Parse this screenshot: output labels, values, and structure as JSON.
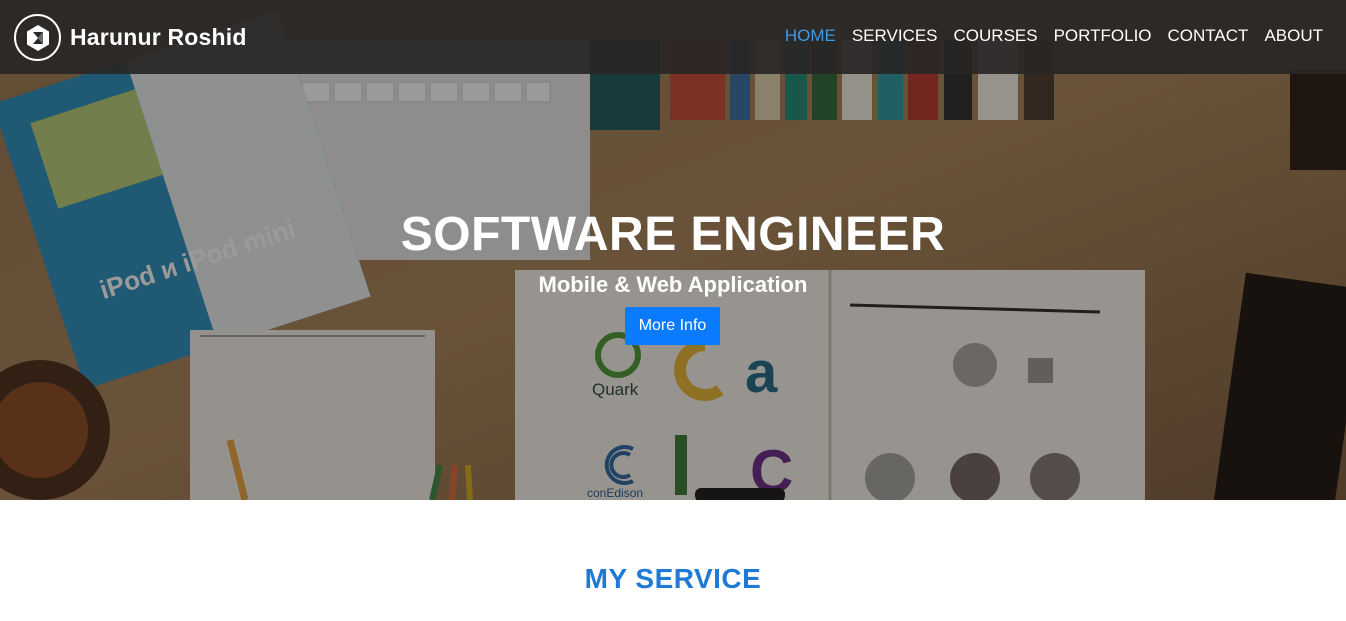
{
  "brand": {
    "name": "Harunur Roshid",
    "logo_icon": "hexagon-logo-icon"
  },
  "nav": {
    "items": [
      {
        "label": "HOME",
        "active": true
      },
      {
        "label": "SERVICES",
        "active": false
      },
      {
        "label": "COURSES",
        "active": false
      },
      {
        "label": "PORTFOLIO",
        "active": false
      },
      {
        "label": "CONTACT",
        "active": false
      },
      {
        "label": "ABOUT",
        "active": false
      }
    ],
    "active_color": "#3d9ae8"
  },
  "hero": {
    "title": "SOFTWARE ENGINEER",
    "subtitle": "Mobile & Web Application",
    "button_label": "More Info",
    "button_color": "#0a7bff",
    "background_image": "desk-workspace-photo",
    "photo_text": {
      "brochure": "iPod и iPod mini",
      "logo_quark": "Quark",
      "logo_conedison": "conEdison"
    }
  },
  "service": {
    "title": "MY SERVICE",
    "title_color": "#1f7ad6"
  }
}
